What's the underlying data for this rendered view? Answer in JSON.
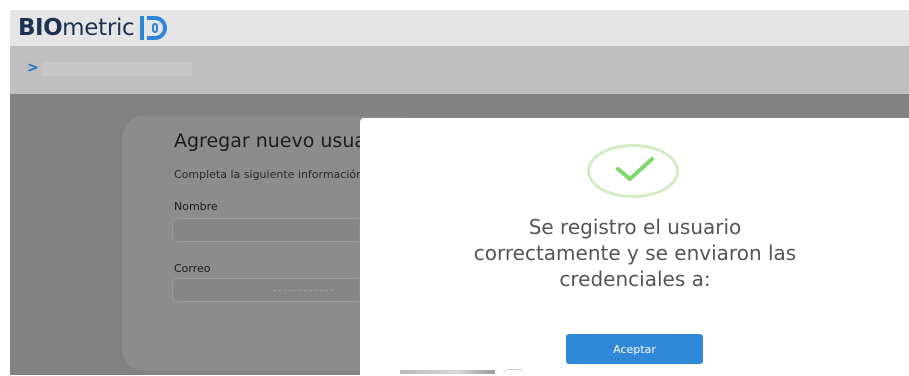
{
  "brand": {
    "bold": "BIO",
    "rest": "metric",
    "suffix": "ID"
  },
  "breadcrumb": {
    "chevron": ">"
  },
  "form": {
    "title": "Agregar nuevo usuario",
    "subtitle": "Completa la siguiente información",
    "fields": [
      {
        "label": "Nombre",
        "value": ""
      },
      {
        "label": "Correo",
        "value": ""
      }
    ]
  },
  "modal": {
    "icon": "success-check-icon",
    "message_lines": [
      "Se registro el usuario",
      "correctamente y se enviaron las",
      "credenciales a:"
    ],
    "button": "Aceptar"
  },
  "colors": {
    "brand_dark": "#1f3150",
    "brand_blue": "#2e84d6",
    "button": "#2f88d8",
    "check": "#7fd66b"
  }
}
